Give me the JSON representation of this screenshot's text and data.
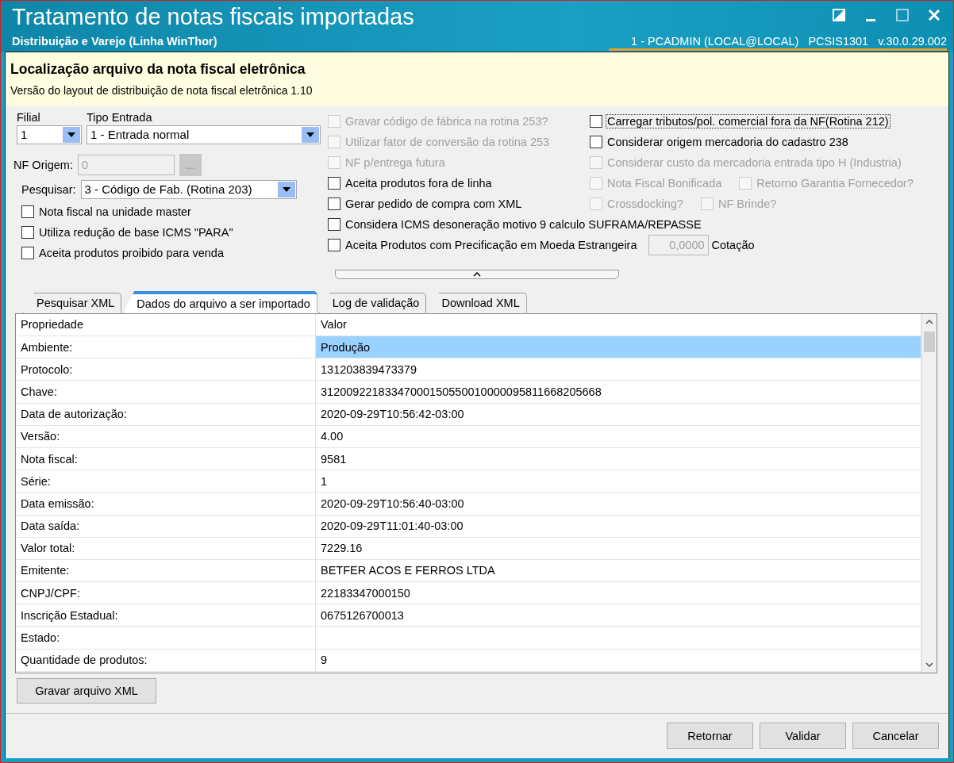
{
  "window": {
    "title": "Tratamento de notas fiscais importadas",
    "subtitle": "Distribuição e Varejo (Linha WinThor)",
    "user": "1 - PCADMIN (LOCAL@LOCAL)",
    "routine": "PCSIS1301",
    "version": "v.30.0.29.002"
  },
  "header": {
    "title": "Localização arquivo da nota fiscal eletrônica",
    "subtitle": "Versão do layout de distribuição de nota fiscal eletrônica 1.10"
  },
  "filial": {
    "label": "Filial",
    "value": "1"
  },
  "tipo_entrada": {
    "label": "Tipo Entrada",
    "value": "1 - Entrada normal"
  },
  "nf_origem": {
    "label": "NF Origem:",
    "value": "0",
    "disabled": true,
    "button": "..."
  },
  "pesquisar": {
    "label": "Pesquisar:",
    "value": "3 - Código de Fab. (Rotina 203)"
  },
  "options_left": [
    {
      "label": "Nota fiscal na unidade master",
      "checked": false,
      "disabled": false,
      "focused": false
    },
    {
      "label": "Utiliza redução de base ICMS \"PARA\"",
      "checked": false,
      "disabled": false,
      "focused": false
    },
    {
      "label": "Aceita produtos proibido para venda",
      "checked": false,
      "disabled": false,
      "focused": false
    }
  ],
  "options_middle": [
    {
      "label": "Gravar código de fábrica na rotina 253?",
      "checked": false,
      "disabled": true,
      "focused": false
    },
    {
      "label": "Utilizar fator de conversão da rotina 253",
      "checked": false,
      "disabled": true,
      "focused": false
    },
    {
      "label": "NF p/entrega futura",
      "checked": false,
      "disabled": true,
      "focused": false
    },
    {
      "label": "Aceita produtos fora de linha",
      "checked": false,
      "disabled": false,
      "focused": false
    },
    {
      "label": "Gerar pedido de compra com XML",
      "checked": false,
      "disabled": false,
      "focused": false
    },
    {
      "label": "Considera ICMS desoneração motivo 9 calculo SUFRAMA/REPASSE",
      "checked": false,
      "disabled": false,
      "focused": false
    },
    {
      "label": "Aceita Produtos com Precificação em Moeda Estrangeira",
      "checked": false,
      "disabled": false,
      "focused": false
    }
  ],
  "cotacao": {
    "value": "0,0000",
    "label": "Cotação",
    "disabled": true
  },
  "options_right": [
    {
      "items": [
        {
          "label": "Carregar tributos/pol. comercial fora da NF(Rotina 212)",
          "checked": false,
          "disabled": false,
          "focused": true
        }
      ]
    },
    {
      "items": [
        {
          "label": "Considerar origem mercadoria do cadastro 238",
          "checked": false,
          "disabled": false,
          "focused": false
        }
      ]
    },
    {
      "items": [
        {
          "label": "Considerar custo da mercadoria entrada tipo H (Industria)",
          "checked": false,
          "disabled": true,
          "focused": false
        }
      ]
    },
    {
      "items": [
        {
          "label": "Nota Fiscal Bonificada",
          "checked": false,
          "disabled": true,
          "focused": false
        },
        {
          "label": "Retorno Garantia Fornecedor?",
          "checked": false,
          "disabled": true,
          "focused": false
        }
      ]
    },
    {
      "items": [
        {
          "label": "Crossdocking?",
          "checked": false,
          "disabled": true,
          "focused": false
        },
        {
          "label": "NF Brinde?",
          "checked": false,
          "disabled": true,
          "focused": false
        }
      ]
    }
  ],
  "tabs": [
    {
      "label": "Pesquisar XML",
      "selected": false
    },
    {
      "label": "Dados do arquivo a ser importado",
      "selected": true
    },
    {
      "label": "Log de validação",
      "selected": false
    },
    {
      "label": "Download XML",
      "selected": false
    }
  ],
  "table": {
    "columns": [
      "Propriedade",
      "Valor"
    ],
    "rows": [
      {
        "cells": [
          "Ambiente:",
          "Produção"
        ],
        "selected": true
      },
      {
        "cells": [
          "Protocolo:",
          "131203839473379"
        ],
        "selected": false
      },
      {
        "cells": [
          "Chave:",
          "31200922183347000150550010000095811668205668"
        ],
        "selected": false
      },
      {
        "cells": [
          "Data de autorização:",
          "2020-09-29T10:56:42-03:00"
        ],
        "selected": false
      },
      {
        "cells": [
          "Versão:",
          "4.00"
        ],
        "selected": false
      },
      {
        "cells": [
          "Nota fiscal:",
          "9581"
        ],
        "selected": false
      },
      {
        "cells": [
          "Série:",
          "1"
        ],
        "selected": false
      },
      {
        "cells": [
          "Data emissão:",
          "2020-09-29T10:56:40-03:00"
        ],
        "selected": false
      },
      {
        "cells": [
          "Data saída:",
          "2020-09-29T11:01:40-03:00"
        ],
        "selected": false
      },
      {
        "cells": [
          "Valor total:",
          "7229.16"
        ],
        "selected": false
      },
      {
        "cells": [
          "Emitente:",
          "BETFER ACOS E FERROS LTDA"
        ],
        "selected": false
      },
      {
        "cells": [
          "CNPJ/CPF:",
          "22183347000150"
        ],
        "selected": false
      },
      {
        "cells": [
          "Inscrição Estadual:",
          "0675126700013"
        ],
        "selected": false
      },
      {
        "cells": [
          "Estado:",
          ""
        ],
        "selected": false
      },
      {
        "cells": [
          "Quantidade de produtos:",
          "9"
        ],
        "selected": false
      }
    ]
  },
  "save_button": "Gravar arquivo XML",
  "footer_buttons": [
    "Retornar",
    "Validar",
    "Cancelar"
  ]
}
